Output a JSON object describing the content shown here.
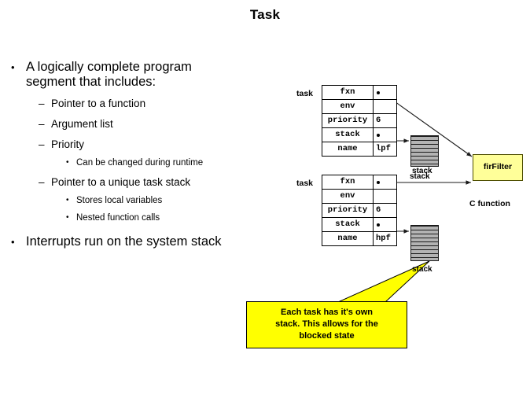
{
  "slide": {
    "title": "Task"
  },
  "bullets": [
    {
      "level": 1,
      "mark": "•",
      "text": "A logically complete program segment that includes:"
    },
    {
      "level": 2,
      "mark": "–",
      "text": "Pointer to a function"
    },
    {
      "level": 2,
      "mark": "–",
      "text": "Argument list"
    },
    {
      "level": 2,
      "mark": "–",
      "text": "Priority"
    },
    {
      "level": 3,
      "mark": "•",
      "text": "Can be changed during runtime"
    },
    {
      "level": 2,
      "mark": "–",
      "text": "Pointer to a unique task stack"
    },
    {
      "level": 3,
      "mark": "•",
      "text": "Stores local variables"
    },
    {
      "level": 3,
      "mark": "•",
      "text": "Nested function calls"
    },
    {
      "level": 1,
      "mark": "•",
      "text": "Interrupts run on the system stack"
    }
  ],
  "diagram": {
    "task1": {
      "label": "task",
      "rows": [
        {
          "name": "fxn",
          "value": "",
          "pointer": true
        },
        {
          "name": "env",
          "value": "",
          "pointer": false
        },
        {
          "name": "priority",
          "value": "6",
          "pointer": false
        },
        {
          "name": "stack",
          "value": "",
          "pointer": true
        },
        {
          "name": "name",
          "value": "lpf",
          "pointer": false
        }
      ],
      "stack_caption": "stack"
    },
    "task2": {
      "label": "task",
      "rows": [
        {
          "name": "fxn",
          "value": "",
          "pointer": true
        },
        {
          "name": "env",
          "value": "",
          "pointer": false
        },
        {
          "name": "priority",
          "value": "6",
          "pointer": false
        },
        {
          "name": "stack",
          "value": "",
          "pointer": true
        },
        {
          "name": "name",
          "value": "hpf",
          "pointer": false
        }
      ],
      "stack_caption": "stack"
    },
    "stack_arrow_label": "stack",
    "fir": {
      "label": "firFilter",
      "caption": "C function",
      "fill_color": "#ffff99"
    },
    "callout": {
      "line1": "Each task has it's own",
      "line2": "stack.  This allows for the",
      "line3": "blocked state",
      "fill_color": "#ffff00"
    }
  }
}
